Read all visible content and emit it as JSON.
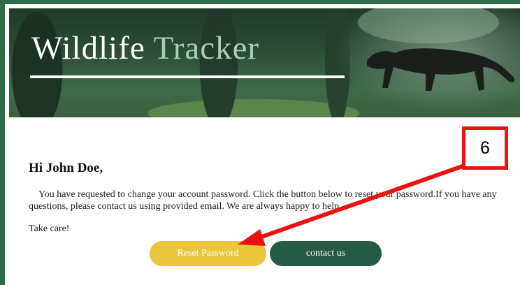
{
  "header": {
    "title_part1": "Wildlife",
    "title_part2": "Tracker"
  },
  "email": {
    "greeting": "Hi John Doe,",
    "body": "You have requested to change your account password. Click the button below to reset your password.If you have any questions, please contact us using provided email. We are always happy to help.",
    "signoff": "Take care!"
  },
  "buttons": {
    "reset_label": "Reset Password",
    "contact_label": "contact us"
  },
  "annotation": {
    "number": "6",
    "color": "#ee1111"
  },
  "colors": {
    "frame": "#2f6b48",
    "reset_button": "#e9c63a",
    "contact_button": "#255a44",
    "title_accent": "#a9cdb7"
  }
}
